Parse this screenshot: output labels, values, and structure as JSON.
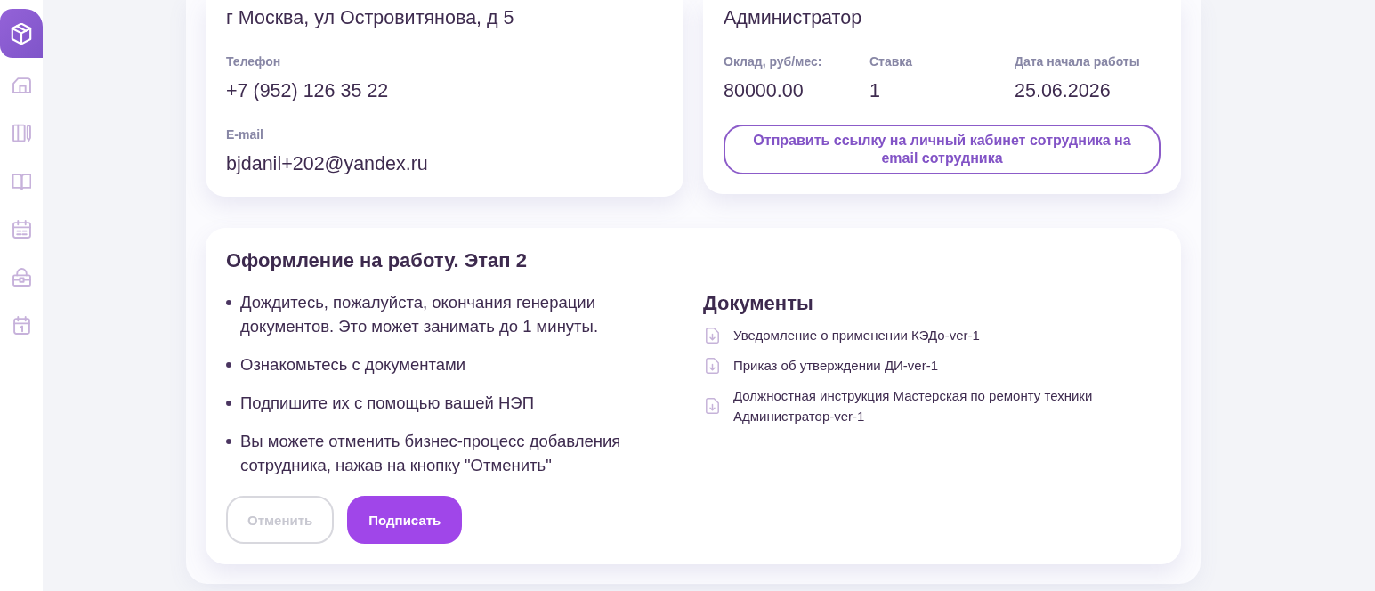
{
  "sidebar": {
    "items": [
      {
        "kind": "box",
        "selected": true
      },
      {
        "kind": "warehouse",
        "selected": false
      },
      {
        "kind": "notebook",
        "selected": false
      },
      {
        "kind": "book",
        "selected": false
      },
      {
        "kind": "calendar",
        "selected": false
      },
      {
        "kind": "bag",
        "selected": false
      },
      {
        "kind": "calendar-day",
        "selected": false
      }
    ]
  },
  "contact_card": {
    "address": "г Москва, ул Островитянова, д 5",
    "fields": [
      {
        "label": "Телефон",
        "value": "+7 (952) 126 35 22"
      },
      {
        "label": "E-mail",
        "value": "bjdanil+202@yandex.ru"
      }
    ]
  },
  "position_card": {
    "position": "Администратор",
    "fields": [
      {
        "label": "Оклад, руб/мес:",
        "value": "80000.00"
      },
      {
        "label": "Ставка",
        "value": "1"
      },
      {
        "label": "Дата начала работы",
        "value": "25.06.2026"
      }
    ],
    "send_link_button": {
      "label": "Отправить ссылку на личный кабинет сотрудника на email сотрудника"
    }
  },
  "onboarding": {
    "title": "Оформление на работу. Этап 2",
    "steps": [
      "Дождитесь, пожалуйста, окончания генерации документов. Это может занимать до 1 минуты.",
      "Ознакомьтесь с документами",
      "Подпишите их с помощью вашей НЭП",
      "Вы можете отменить бизнес-процесс добавления сотрудника, нажав на кнопку \"Отменить\""
    ],
    "buttons": [
      {
        "label": "Отменить",
        "kind": "secondary",
        "disabled": true
      },
      {
        "label": "Подписать",
        "kind": "primary",
        "disabled": false
      }
    ],
    "documents": {
      "title": "Документы",
      "items": [
        "Уведомление о применении КЭДо-ver-1",
        "Приказ об утверждении ДИ-ver-1",
        "Должностная инструкция Мастерская по ремонту техники Администратор-ver-1"
      ]
    }
  }
}
